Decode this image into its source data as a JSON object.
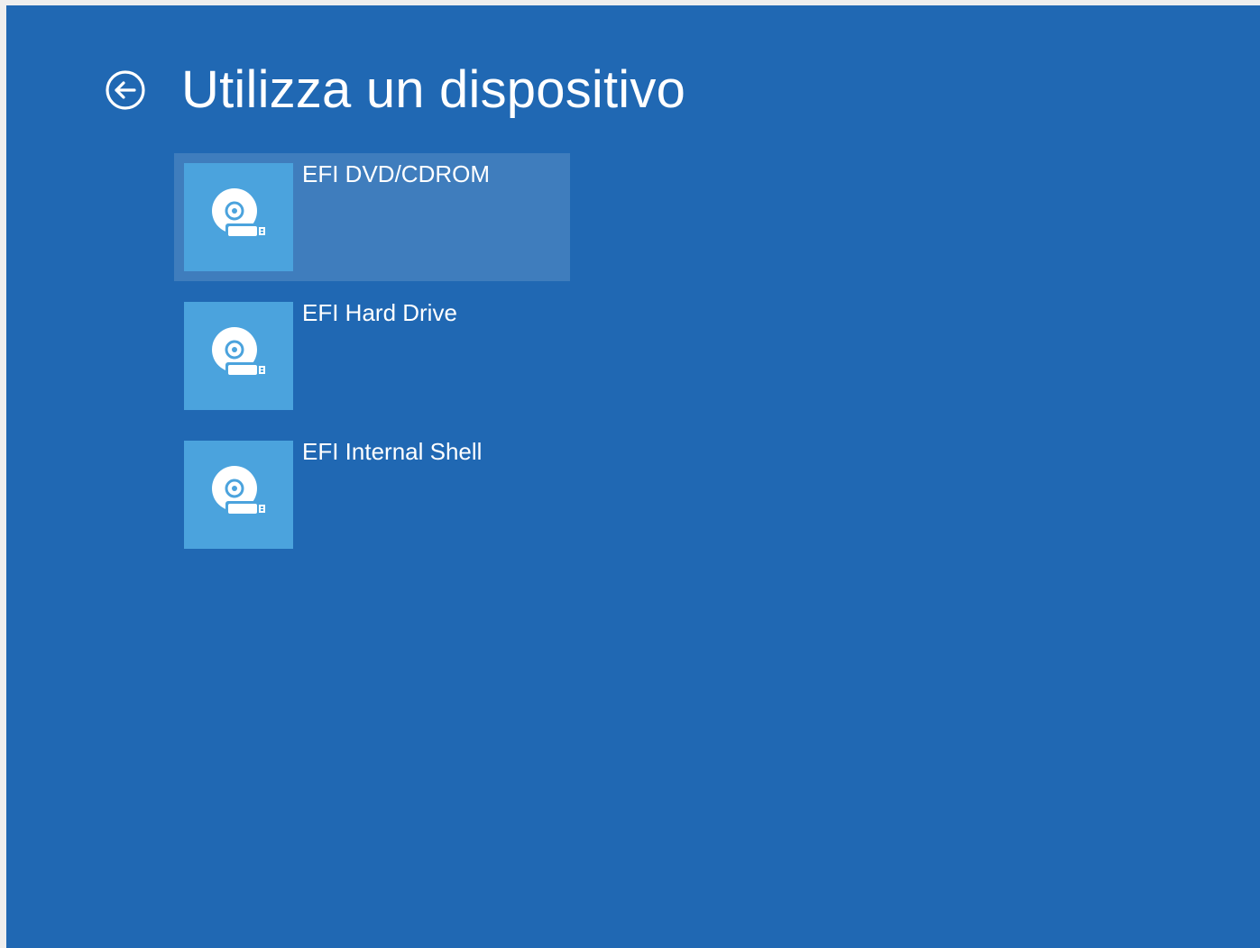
{
  "page": {
    "title": "Utilizza un dispositivo",
    "back_icon": "back-arrow-circle-icon"
  },
  "colors": {
    "background": "#2068b3",
    "tile": "#4ba3dd",
    "text": "#ffffff",
    "selection": "rgba(255,255,255,0.14)"
  },
  "devices": [
    {
      "label": "EFI DVD/CDROM",
      "icon": "disk-drive-icon",
      "selected": true
    },
    {
      "label": "EFI Hard Drive",
      "icon": "disk-drive-icon",
      "selected": false
    },
    {
      "label": "EFI Internal Shell",
      "icon": "disk-drive-icon",
      "selected": false
    }
  ]
}
